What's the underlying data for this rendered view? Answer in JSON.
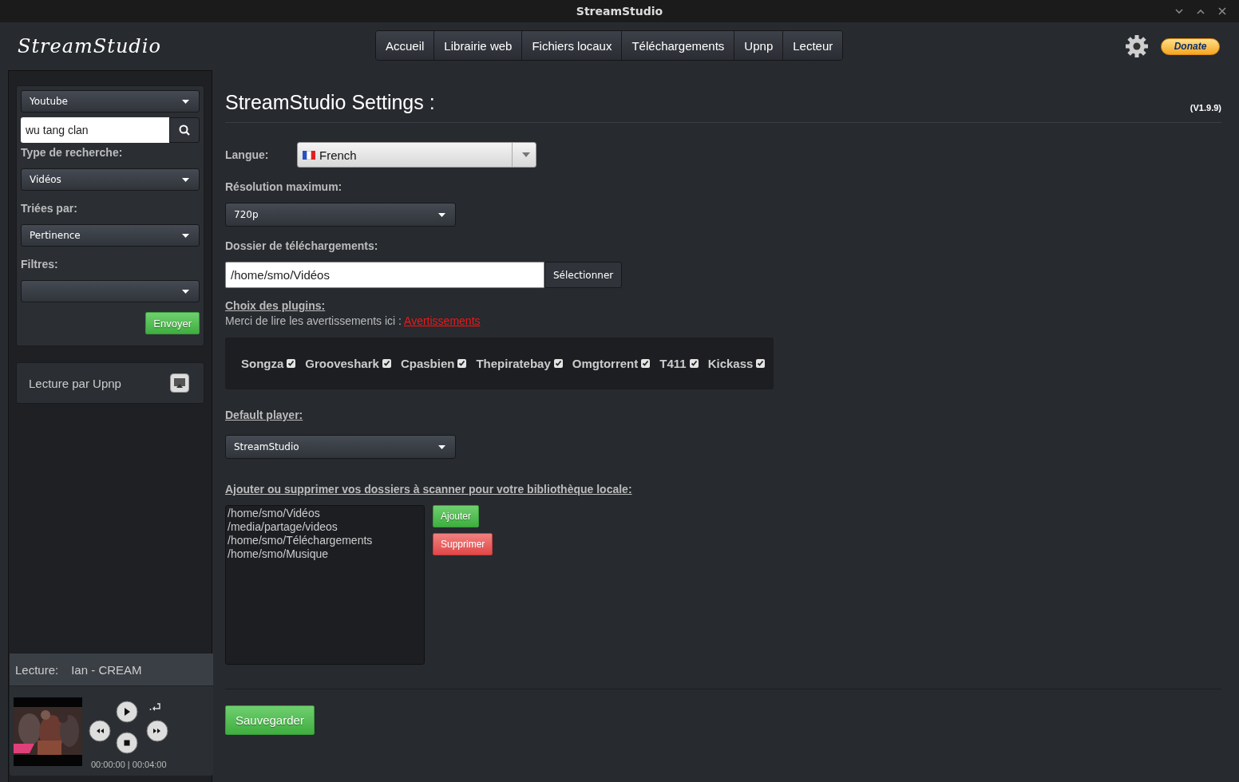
{
  "window": {
    "title": "StreamStudio"
  },
  "header": {
    "logo": "StreamStudio",
    "donate": "Donate"
  },
  "nav": {
    "tabs": [
      {
        "label": "Accueil",
        "selected": false
      },
      {
        "label": "Librairie web",
        "selected": false
      },
      {
        "label": "Fichiers locaux",
        "selected": false
      },
      {
        "label": "Téléchargements",
        "selected": false
      },
      {
        "label": "Upnp",
        "selected": false
      },
      {
        "label": "Lecteur",
        "selected": false
      }
    ]
  },
  "sidebar": {
    "source": "Youtube",
    "search": {
      "value": "wu tang clan"
    },
    "fields": [
      {
        "label": "Type de recherche:",
        "value": "Vidéos"
      },
      {
        "label": "Triées par:",
        "value": "Pertinence"
      },
      {
        "label": "Filtres:"
      }
    ],
    "submit": "Envoyer",
    "upnp": "Lecture par Upnp",
    "player": {
      "label": "Lecture:",
      "track": "Ian - CREAM",
      "time": "00:00:00 | 00:04:00"
    }
  },
  "settings": {
    "title": "StreamStudio Settings :",
    "version": "(V1.9.9)",
    "language": {
      "label": "Langue:",
      "value": "French"
    },
    "resolution": {
      "label": "Résolution maximum:",
      "value": "720p"
    },
    "download": {
      "label": "Dossier de téléchargements:",
      "value": "/home/smo/Vidéos",
      "button": "Sélectionner"
    },
    "plugins": {
      "heading": "Choix des plugins:",
      "notice": "Merci de lire les avertissements ici :",
      "link": "Avertissements",
      "items": [
        {
          "name": "Songza",
          "checked": true
        },
        {
          "name": "Grooveshark",
          "checked": true
        },
        {
          "name": "Cpasbien",
          "checked": true
        },
        {
          "name": "Thepiratebay",
          "checked": true
        },
        {
          "name": "Omgtorrent",
          "checked": true
        },
        {
          "name": "T411",
          "checked": true
        },
        {
          "name": "Kickass",
          "checked": true
        }
      ]
    },
    "player": {
      "heading": "Default player:",
      "value": "StreamStudio"
    },
    "library": {
      "heading": "Ajouter ou supprimer vos dossiers à scanner pour votre bibliothèque locale:",
      "folders": [
        "/home/smo/Vidéos",
        "/media/partage/videos",
        "/home/smo/Téléchargements",
        "/home/smo/Musique"
      ],
      "add": "Ajouter",
      "remove": "Supprimer"
    },
    "save": "Sauvegarder"
  }
}
